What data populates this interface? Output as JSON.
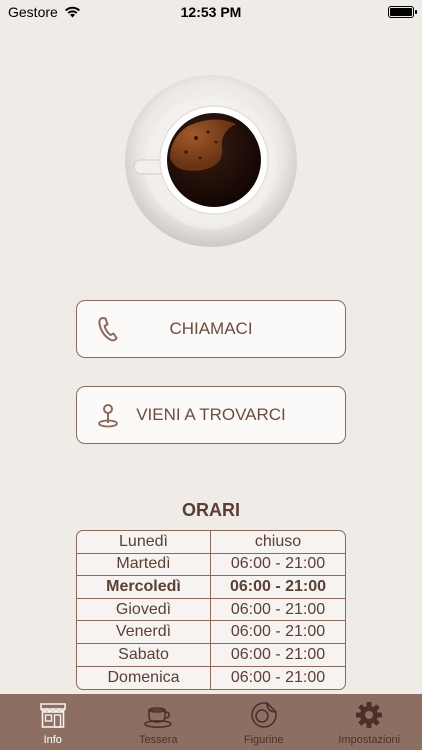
{
  "status": {
    "carrier": "Gestore",
    "time": "12:53 PM"
  },
  "actions": {
    "call_label": "CHIAMACI",
    "visit_label": "VIENI A TROVARCI"
  },
  "hours": {
    "title": "ORARI",
    "rows": [
      {
        "day": "Lunedì",
        "time": "chiuso"
      },
      {
        "day": "Martedì",
        "time": "06:00 - 21:00"
      },
      {
        "day": "Mercoledì",
        "time": "06:00 - 21:00"
      },
      {
        "day": "Giovedì",
        "time": "06:00 - 21:00"
      },
      {
        "day": "Venerdì",
        "time": "06:00 - 21:00"
      },
      {
        "day": "Sabato",
        "time": "06:00 - 21:00"
      },
      {
        "day": "Domenica",
        "time": "06:00 - 21:00"
      }
    ],
    "highlighted_day": "Mercoledì"
  },
  "tabs": [
    {
      "label": "Info",
      "icon": "store-icon",
      "active": true
    },
    {
      "label": "Tessera",
      "icon": "coffee-cup-icon",
      "active": false
    },
    {
      "label": "Figurine",
      "icon": "sticker-icon",
      "active": false
    },
    {
      "label": "Impostazioni",
      "icon": "gear-icon",
      "active": false
    }
  ],
  "colors": {
    "background": "#EFEBE7",
    "accent": "#8D6E63",
    "text": "#5A4035"
  }
}
